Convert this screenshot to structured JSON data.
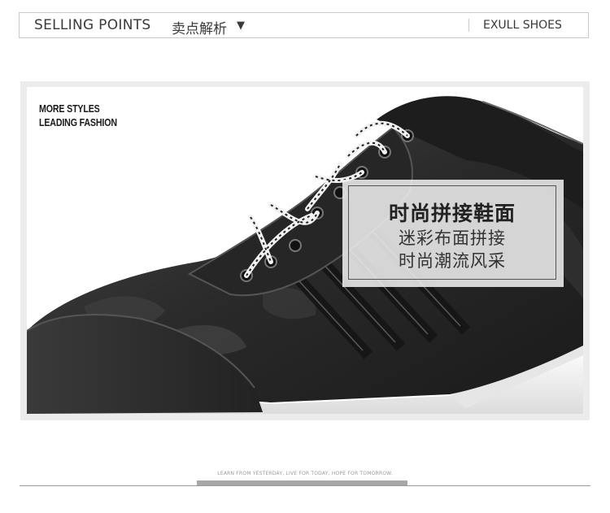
{
  "header": {
    "title_en": "SELLING POINTS",
    "title_cn": "卖点解析",
    "dropdown_arrow": "▼",
    "brand": "EXULL SHOES"
  },
  "photo": {
    "slogan_line1": "MORE STYLES",
    "slogan_line2": "LEADING FASHION",
    "subject": "black camouflage sneaker with white laces"
  },
  "callout": {
    "heading": "时尚拼接鞋面",
    "line1": "迷彩布面拼接",
    "line2": "时尚潮流风采"
  },
  "footer": {
    "tagline": "LEARN FROM YESTERDAY, LIVE FOR TODAY, HOPE FOR TOMORROW."
  },
  "colors": {
    "header_border": "#c9c9c9",
    "text_dark": "#3a3a3a",
    "shoe_black": "#2b2b2b",
    "sole_white": "#f4f4f4"
  }
}
